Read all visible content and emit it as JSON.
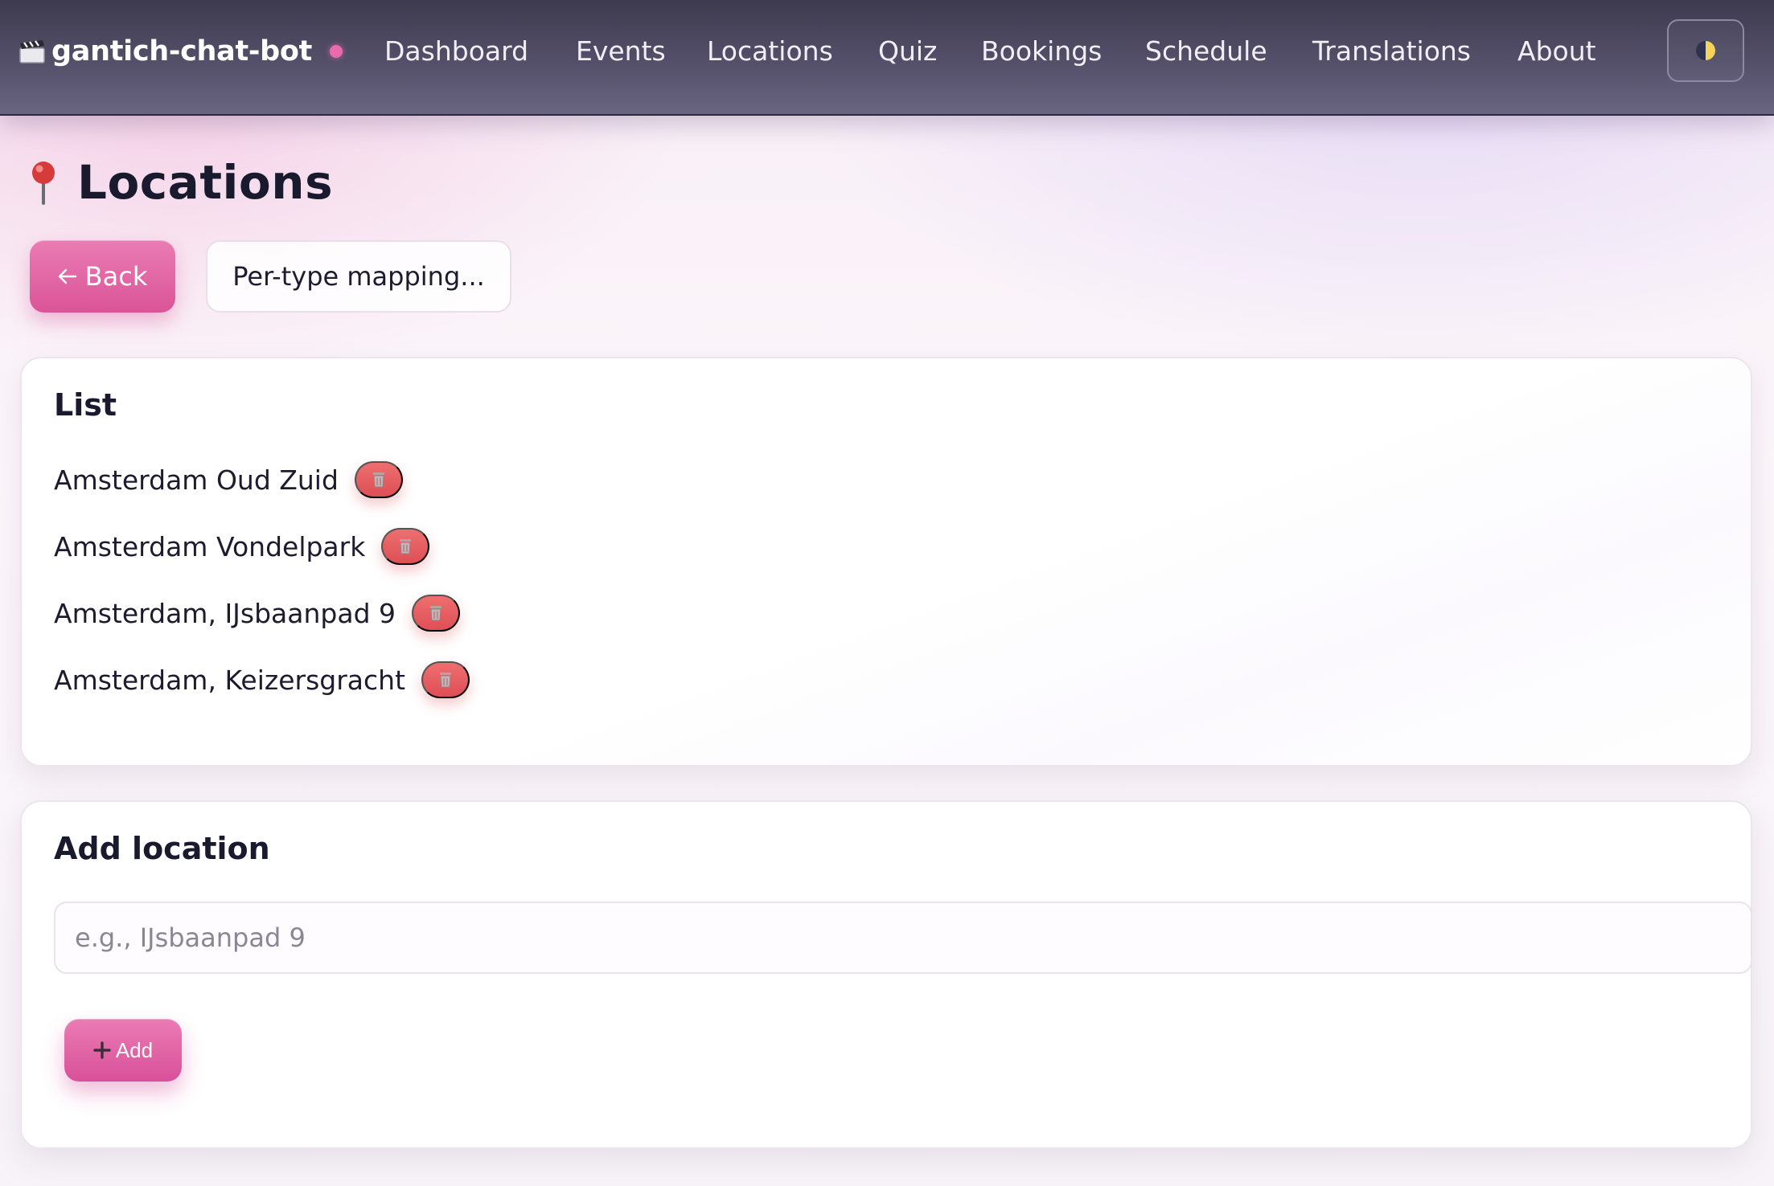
{
  "app": {
    "name": "gantich-chat-bot",
    "status_color": "#e86bb0",
    "logo_icon": "clapperboard-icon"
  },
  "nav": {
    "items": [
      {
        "label": "Dashboard"
      },
      {
        "label": "Events"
      },
      {
        "label": "Locations"
      },
      {
        "label": "Quiz"
      },
      {
        "label": "Bookings"
      },
      {
        "label": "Schedule"
      },
      {
        "label": "Translations"
      },
      {
        "label": "About"
      }
    ],
    "theme_toggle_icon": "half-moon-icon"
  },
  "page": {
    "title": "Locations",
    "title_icon": "pushpin-icon",
    "back_label": "Back",
    "mapping_label": "Per-type mapping..."
  },
  "list": {
    "title": "List",
    "items": [
      {
        "name": "Amsterdam Oud Zuid"
      },
      {
        "name": "Amsterdam Vondelpark"
      },
      {
        "name": "Amsterdam, IJsbaanpad 9"
      },
      {
        "name": "Amsterdam, Keizersgracht"
      }
    ],
    "delete_icon": "trash-icon"
  },
  "add_form": {
    "title": "Add location",
    "placeholder": "e.g., IJsbaanpad 9",
    "value": "",
    "add_label": "Add"
  },
  "colors": {
    "accent": "#da5498",
    "danger": "#de4f55",
    "nav_bg": "#4a4660"
  }
}
